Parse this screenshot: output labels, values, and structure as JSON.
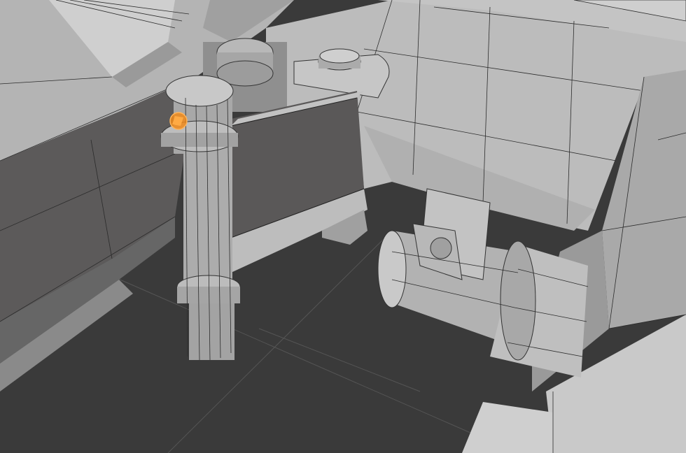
{
  "app": {
    "name": "3D viewport",
    "mode": "edit-mode"
  },
  "viewport": {
    "background_color": "#3a3a3a",
    "floor_color": "#383838",
    "surface_light": "#c8c8c8",
    "surface_mid": "#a8a8a8",
    "surface_dark": "#5e5e5e",
    "wire_color": "#2b2b2b",
    "selection_color": "#f08a1a",
    "objects": [
      {
        "name": "hull-panel-left"
      },
      {
        "name": "back-wall"
      },
      {
        "name": "right-block"
      },
      {
        "name": "vertical-pillar"
      },
      {
        "name": "support-bracket"
      },
      {
        "name": "top-tab-with-bolt"
      },
      {
        "name": "gear-stack"
      },
      {
        "name": "cylinder-assembly"
      },
      {
        "name": "selected-vertex"
      }
    ]
  }
}
